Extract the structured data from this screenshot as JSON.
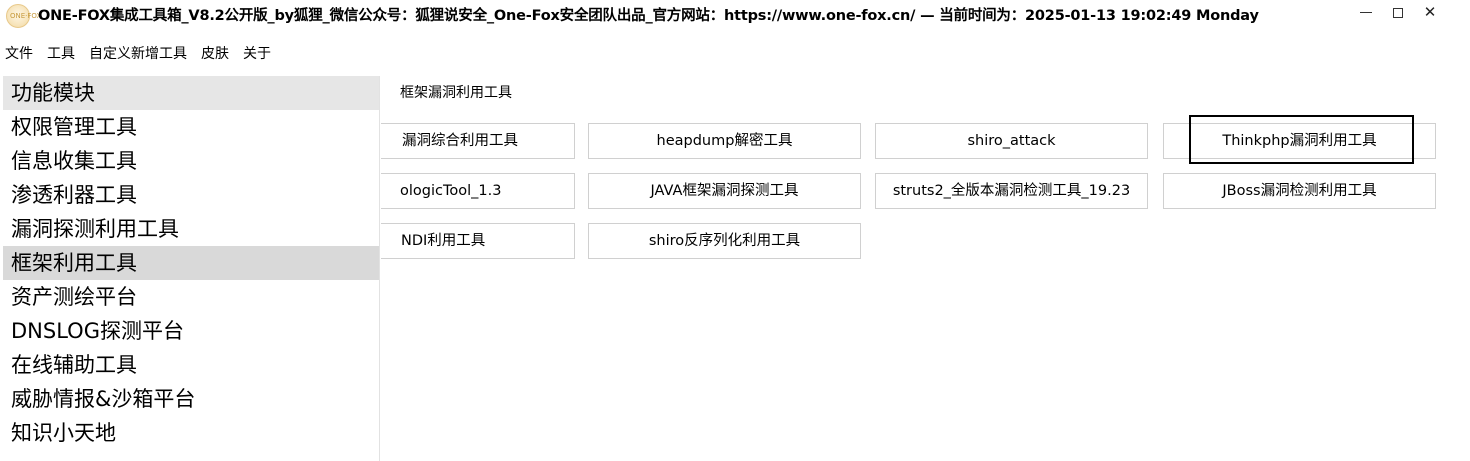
{
  "window": {
    "title": "ONE-FOX集成工具箱_V8.2公开版_by狐狸_微信公众号：狐狸说安全_One-Fox安全团队出品_官方网站：https://www.one-fox.cn/ — 当前时间为：2025-01-13 19:02:49   Monday",
    "logo_text": "ONE·FOX"
  },
  "menubar": {
    "items": [
      "文件",
      "工具",
      "自定义新增工具",
      "皮肤",
      "关于"
    ]
  },
  "sidebar": {
    "header": "功能模块",
    "items": [
      "权限管理工具",
      "信息收集工具",
      "渗透利器工具",
      "漏洞探测利用工具",
      "框架利用工具",
      "资产测绘平台",
      "DNSLOG探测平台",
      "在线辅助工具",
      "威胁情报&沙箱平台",
      "知识小天地"
    ],
    "selected": "框架利用工具"
  },
  "content": {
    "section_title": "框架漏洞利用工具",
    "buttons": [
      "漏洞综合利用工具",
      "heapdump解密工具",
      "shiro_attack",
      "Thinkphp漏洞利用工具",
      "ologicTool_1.3",
      "JAVA框架漏洞探测工具",
      "struts2_全版本漏洞检测工具_19.23",
      "JBoss漏洞检测利用工具",
      "NDI利用工具",
      "shiro反序列化利用工具"
    ]
  }
}
